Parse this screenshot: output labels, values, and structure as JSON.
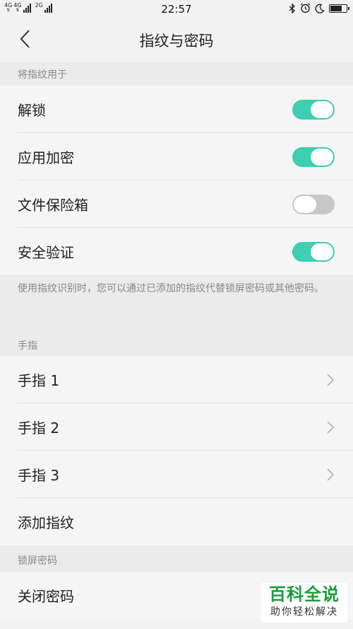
{
  "status_bar": {
    "network_1": "4G",
    "network_2": "4G",
    "network_3": "2G",
    "time": "22:57",
    "icons": [
      "bluetooth-icon",
      "alarm-icon",
      "moon-icon",
      "battery-icon"
    ]
  },
  "header": {
    "title": "指纹与密码"
  },
  "section_fingerprint_use": {
    "title": "将指纹用于",
    "items": [
      {
        "label": "解锁",
        "enabled": true
      },
      {
        "label": "应用加密",
        "enabled": true
      },
      {
        "label": "文件保险箱",
        "enabled": false
      },
      {
        "label": "安全验证",
        "enabled": true
      }
    ],
    "note": "使用指纹识别时，您可以通过已添加的指纹代替锁屏密码或其他密码。"
  },
  "section_fingers": {
    "title": "手指",
    "items": [
      {
        "label": "手指 1"
      },
      {
        "label": "手指 2"
      },
      {
        "label": "手指 3"
      }
    ],
    "add_label": "添加指纹"
  },
  "section_lock_password": {
    "title": "锁屏密码",
    "items": [
      {
        "label": "关闭密码"
      }
    ]
  },
  "watermark": {
    "main": "百科全说",
    "sub": "助你轻松解决"
  },
  "colors": {
    "toggle_on": "#3dcfb0",
    "toggle_off": "#c8c8c8",
    "watermark_green": "#1a9d3c"
  }
}
